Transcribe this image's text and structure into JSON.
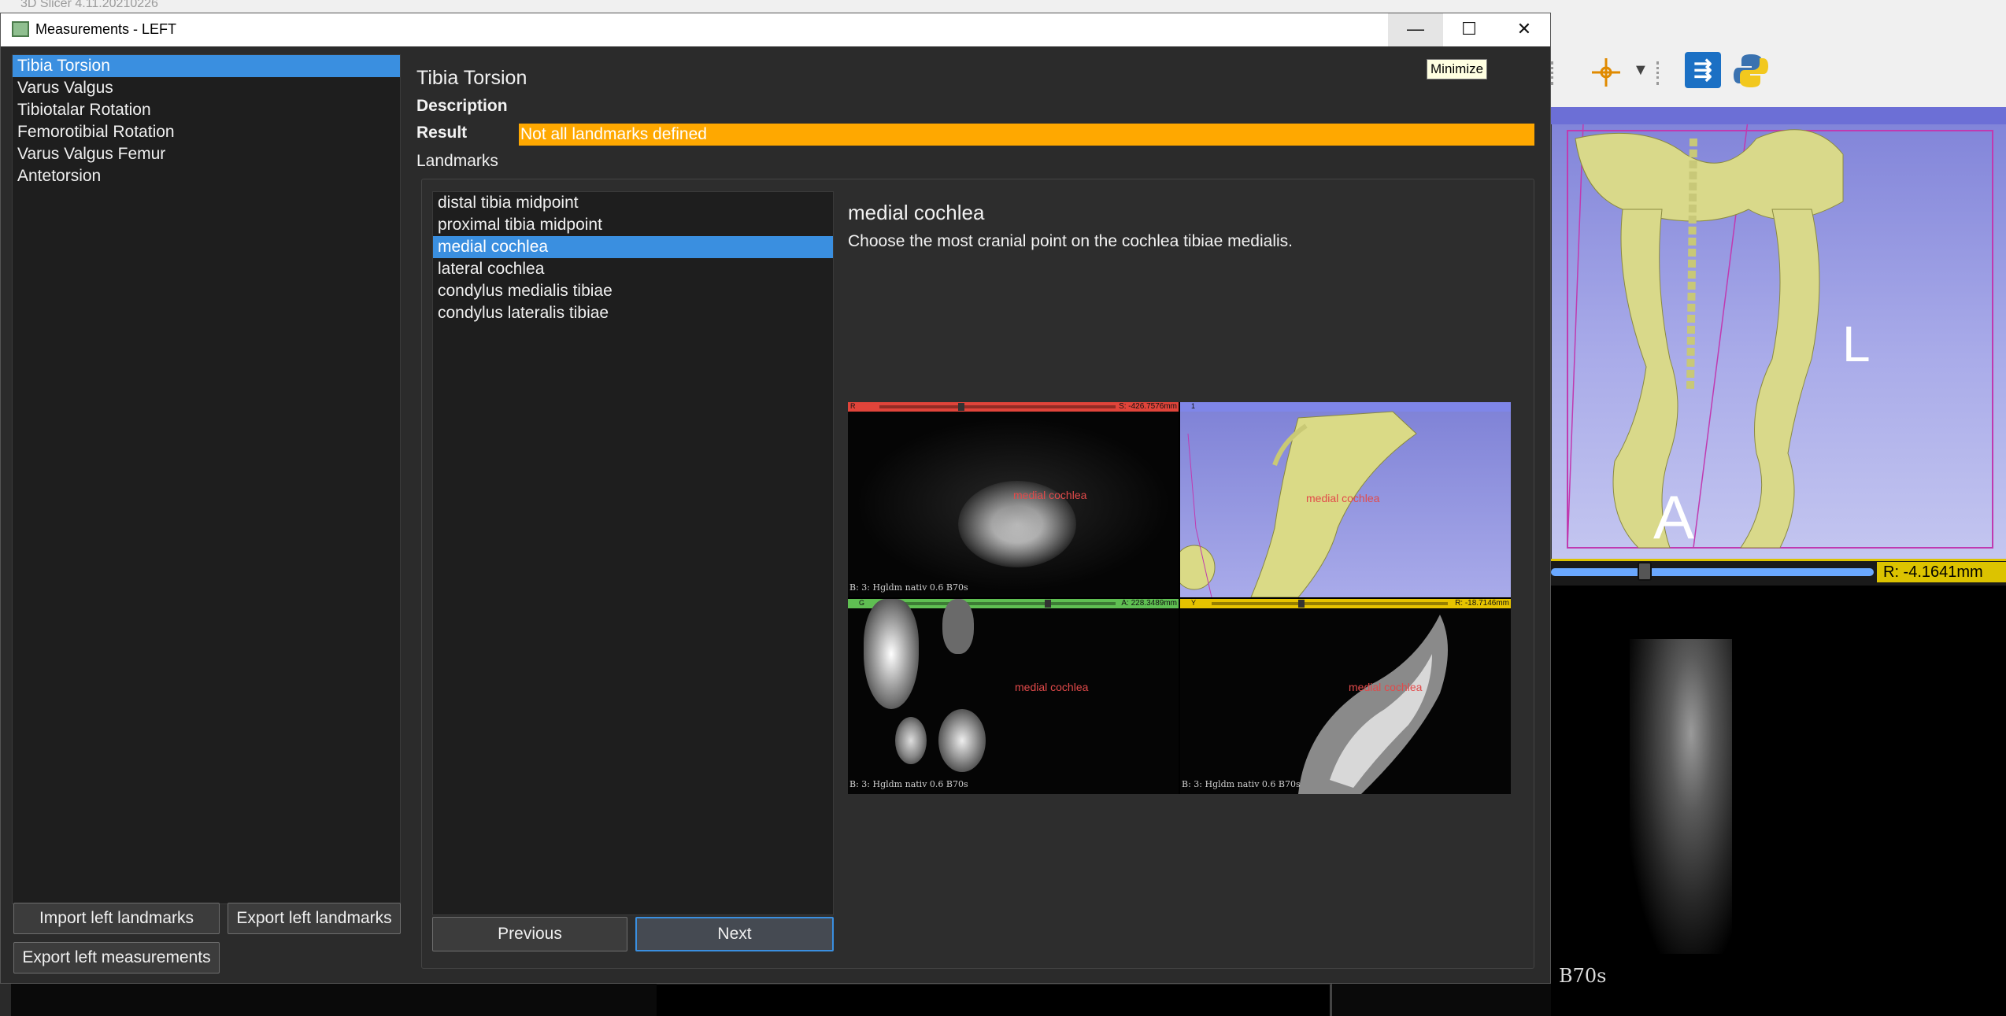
{
  "background_app": {
    "title": "3D Slicer 4.11.20210226",
    "slice_readout": "R: -4.1641mm",
    "orientation_left": "L",
    "orientation_anterior": "A",
    "series_caption": "B70s"
  },
  "window": {
    "title": "Measurements - LEFT",
    "min_glyph": "—",
    "max_glyph": "☐",
    "close_glyph": "✕"
  },
  "measurements": {
    "items": [
      {
        "label": "Tibia Torsion"
      },
      {
        "label": "Varus Valgus"
      },
      {
        "label": "Tibiotalar Rotation"
      },
      {
        "label": "Femorotibial Rotation"
      },
      {
        "label": "Varus Valgus Femur"
      },
      {
        "label": "Antetorsion"
      }
    ],
    "selected_index": 0,
    "import_button": "Import left landmarks",
    "export_landmarks_button": "Export left landmarks",
    "export_measurements_button": "Export left measurements"
  },
  "detail": {
    "title": "Tibia Torsion",
    "description_label": "Description",
    "result_label": "Result",
    "result_value": "Not all landmarks defined",
    "landmarks_label": "Landmarks",
    "minimize_label": "Minimize"
  },
  "landmarks": {
    "items": [
      {
        "label": "distal tibia midpoint"
      },
      {
        "label": "proximal tibia midpoint"
      },
      {
        "label": "medial cochlea"
      },
      {
        "label": "lateral cochlea"
      },
      {
        "label": "condylus medialis tibiae"
      },
      {
        "label": "condylus lateralis tibiae"
      }
    ],
    "selected_index": 2,
    "previous_button": "Previous",
    "next_button": "Next",
    "selected_name": "medial cochlea",
    "selected_description": "Choose the most cranial point on the cochlea tibiae medialis."
  },
  "views": {
    "red": {
      "tag": "R",
      "readout": "S: -426.7576mm",
      "caption": "B: 3: Hgldm nativ  0.6   B70s",
      "marker": "medial cochlea"
    },
    "three_d": {
      "tag": "1",
      "marker": "medial cochlea"
    },
    "green": {
      "tag": "G",
      "readout": "A: 228.3489mm",
      "caption": "B: 3: Hgldm nativ  0.6   B70s",
      "marker": "medial cochlea"
    },
    "yellow": {
      "tag": "Y",
      "readout": "R: -18.7146mm",
      "caption": "B: 3: Hgldm nativ  0.6   B70s",
      "marker": "medial cochlea"
    }
  },
  "colors": {
    "accent": "#3a8fe0",
    "result_warning": "#ffa800",
    "red_view": "#e0443a",
    "green_view": "#5fbf52",
    "yellow_view": "#e6c300",
    "three_d_view": "#7f86e8"
  }
}
